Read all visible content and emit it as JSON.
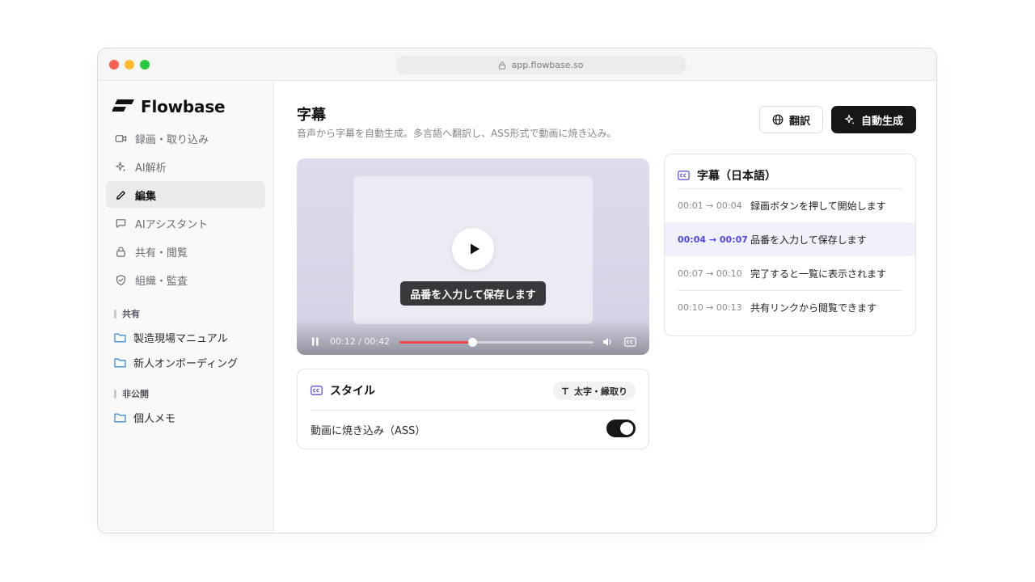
{
  "browser": {
    "url": "app.flowbase.so"
  },
  "brand": {
    "name": "Flowbase"
  },
  "sidebar": {
    "nav": [
      {
        "label": "録画・取り込み",
        "icon": "video-icon",
        "active": false
      },
      {
        "label": "AI解析",
        "icon": "sparkle-icon",
        "active": false
      },
      {
        "label": "編集",
        "icon": "pencil-icon",
        "active": true
      },
      {
        "label": "AIアシスタント",
        "icon": "chat-icon",
        "active": false
      },
      {
        "label": "共有・閲覧",
        "icon": "lock-icon",
        "active": false
      },
      {
        "label": "組織・監査",
        "icon": "shield-icon",
        "active": false
      }
    ],
    "sections": [
      {
        "label": "共有",
        "folders": [
          "製造現場マニュアル",
          "新人オンボーディング"
        ]
      },
      {
        "label": "非公開",
        "folders": [
          "個人メモ"
        ]
      }
    ]
  },
  "header": {
    "title": "字幕",
    "description": "音声から字幕を自動生成。多言語へ翻訳し、ASS形式で動画に焼き込み。",
    "translate_label": "翻訳",
    "generate_label": "自動生成"
  },
  "player": {
    "caption": "品番を入力して保存します",
    "time_display": "00:12 / 00:42",
    "progress": 0.376
  },
  "style_card": {
    "title": "スタイル",
    "chip_label": "太字・縁取り",
    "burn_in_label": "動画に焼き込み（ASS）",
    "burn_in_enabled": true
  },
  "subtitles": {
    "title": "字幕（日本語）",
    "items": [
      {
        "start": "00:01",
        "end": "00:04",
        "text": "録画ボタンを押して開始します",
        "active": false
      },
      {
        "start": "00:04",
        "end": "00:07",
        "text": "品番を入力して保存します",
        "active": true
      },
      {
        "start": "00:07",
        "end": "00:10",
        "text": "完了すると一覧に表示されます",
        "active": false
      },
      {
        "start": "00:10",
        "end": "00:13",
        "text": "共有リンクから閲覧できます",
        "active": false
      }
    ]
  },
  "colors": {
    "accent": "#4f46e5",
    "primary_button": "#17171a",
    "progress": "#f24646",
    "active_row": "#f1f1fb"
  }
}
